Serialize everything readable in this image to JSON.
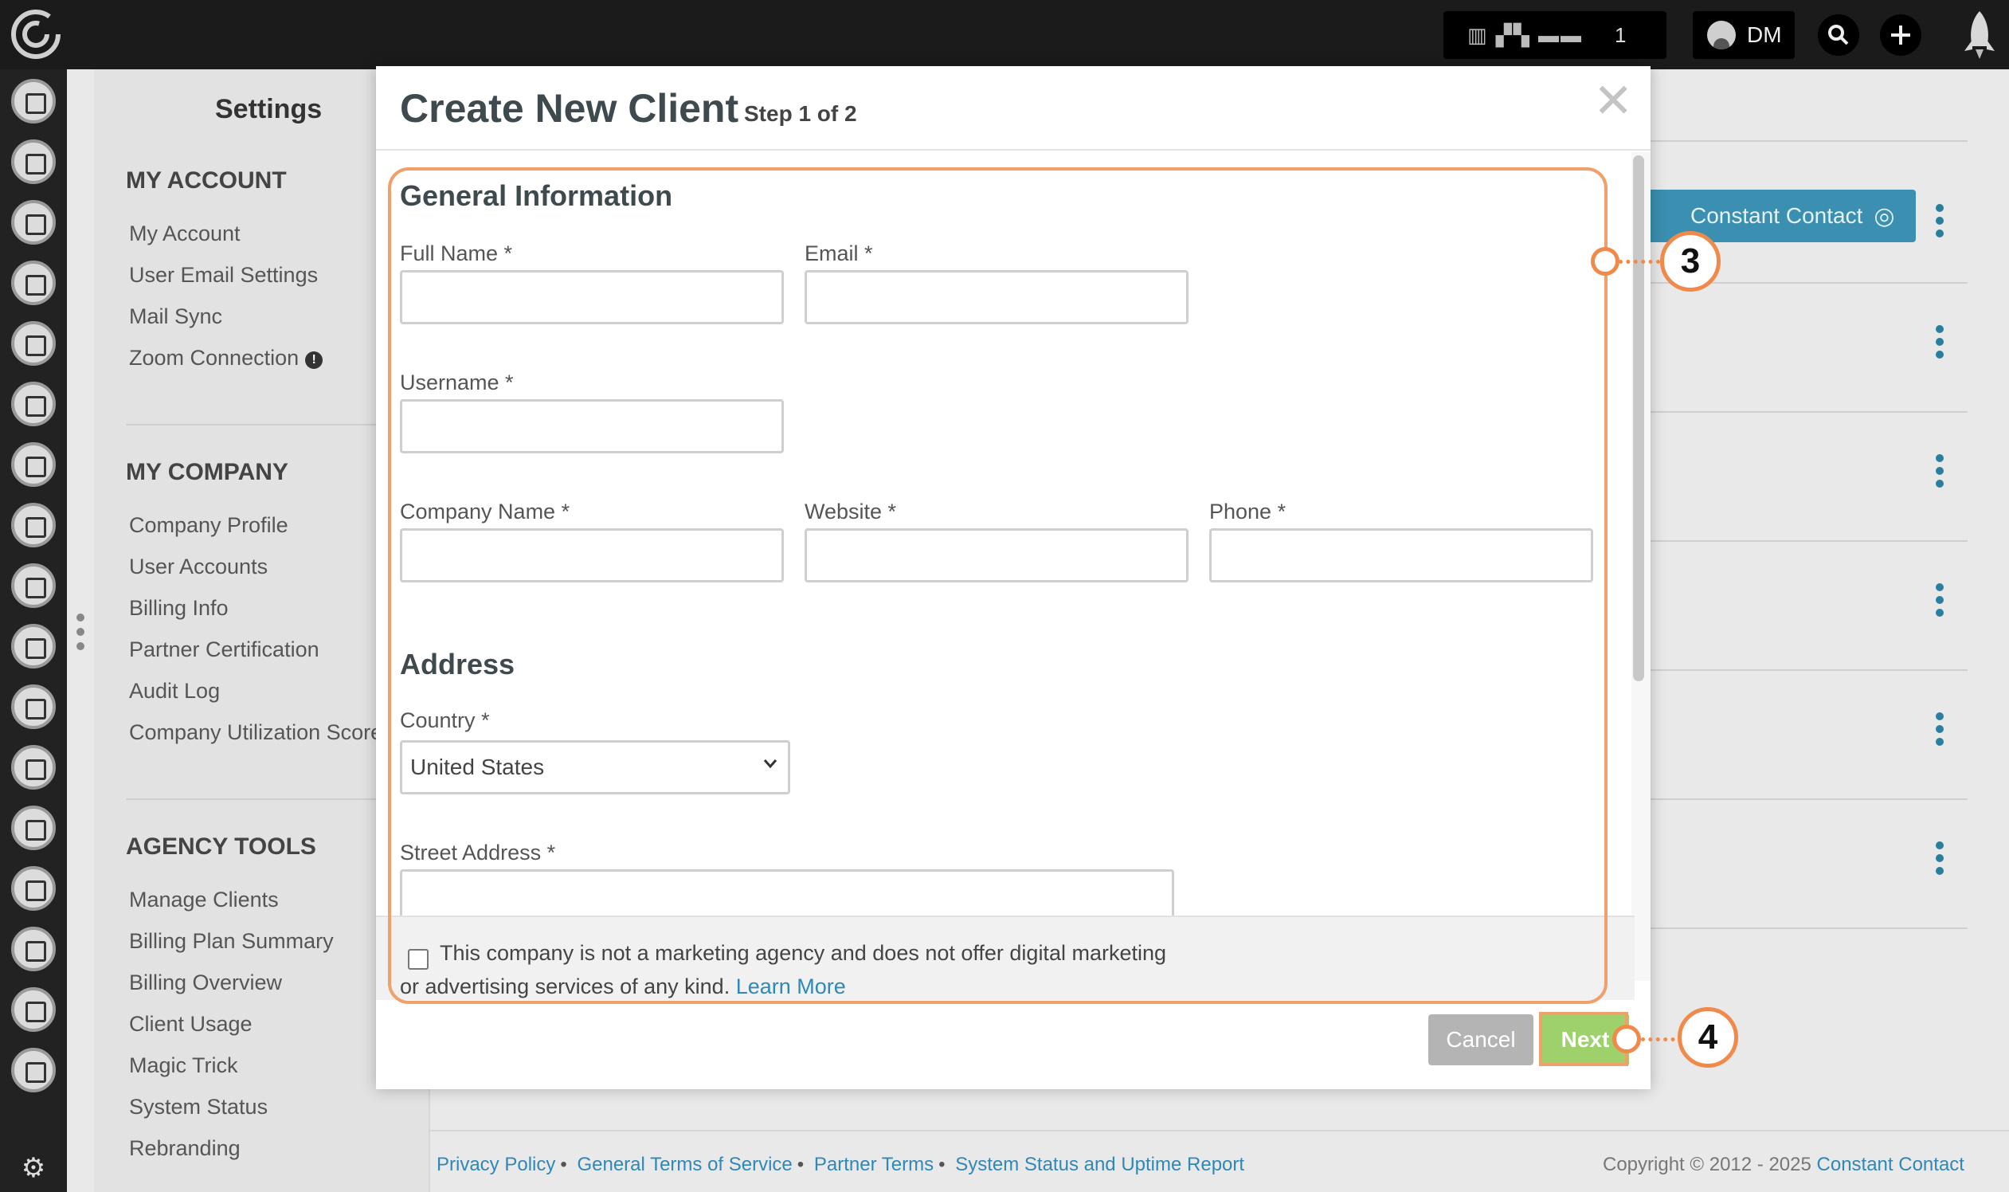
{
  "topbar": {
    "user_initials": "DM",
    "counter": "1"
  },
  "settings": {
    "title": "Settings",
    "my_account": {
      "heading": "MY ACCOUNT",
      "items": [
        "My Account",
        "User Email Settings",
        "Mail Sync",
        "Zoom Connection"
      ]
    },
    "my_company": {
      "heading": "MY COMPANY",
      "items": [
        "Company Profile",
        "User Accounts",
        "Billing Info",
        "Partner Certification",
        "Audit Log",
        "Company Utilization Score"
      ]
    },
    "agency_tools": {
      "heading": "AGENCY TOOLS",
      "items": [
        "Manage Clients",
        "Billing Plan Summary",
        "Billing Overview",
        "Client Usage",
        "Magic Trick",
        "System Status",
        "Rebranding"
      ]
    }
  },
  "main": {
    "constant_contact_button": "Constant Contact"
  },
  "footer": {
    "links": [
      "Privacy Policy",
      "General Terms of Service",
      "Partner Terms",
      "System Status and Uptime Report"
    ],
    "copyright": "Copyright © 2012 - 2025",
    "brand": "Constant Contact"
  },
  "modal": {
    "title": "Create New Client",
    "step": "Step 1 of 2",
    "general_heading": "General Information",
    "fields": {
      "full_name": {
        "label": "Full Name *",
        "value": ""
      },
      "email": {
        "label": "Email *",
        "value": ""
      },
      "username": {
        "label": "Username *",
        "value": ""
      },
      "company_name": {
        "label": "Company Name *",
        "value": ""
      },
      "website": {
        "label": "Website *",
        "value": ""
      },
      "phone": {
        "label": "Phone *",
        "value": ""
      }
    },
    "address_heading": "Address",
    "country": {
      "label": "Country *",
      "value": "United States"
    },
    "street_address": {
      "label": "Street Address *",
      "value": ""
    },
    "checkbox_text_line1": "This company is not a marketing agency and does not offer digital marketing",
    "checkbox_text_line2": "or advertising services of any kind.",
    "learn_more": "Learn More",
    "cancel_label": "Cancel",
    "next_label": "Next"
  },
  "annotations": {
    "step3": "3",
    "step4": "4",
    "highlight_color": "#f08a4b"
  }
}
